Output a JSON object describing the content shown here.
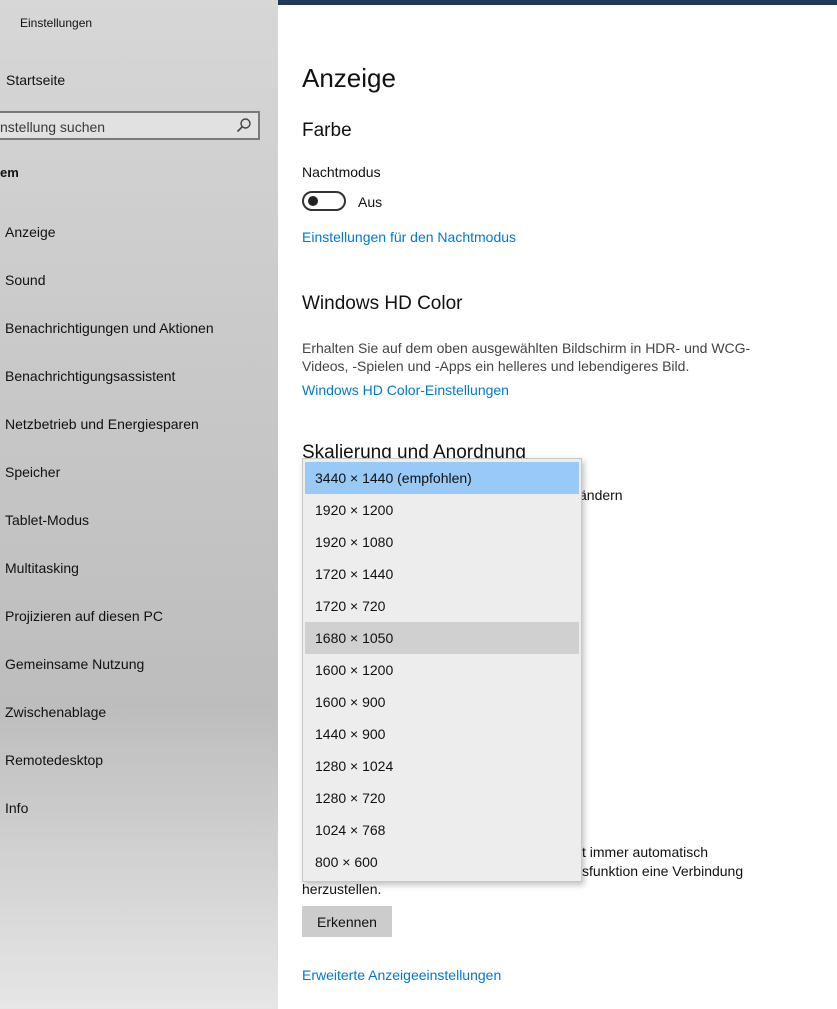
{
  "app": {
    "title": "Einstellungen"
  },
  "sidebar": {
    "home": "Startseite",
    "search_placeholder": "nstellung suchen",
    "group": "em",
    "items": [
      "Anzeige",
      "Sound",
      "Benachrichtigungen und Aktionen",
      "Benachrichtigungsassistent",
      "Netzbetrieb und Energiesparen",
      "Speicher",
      "Tablet-Modus",
      "Multitasking",
      "Projizieren auf diesen PC",
      "Gemeinsame Nutzung",
      "Zwischenablage",
      "Remotedesktop",
      "Info"
    ]
  },
  "main": {
    "title": "Anzeige",
    "color_heading": "Farbe",
    "night_mode_label": "Nachtmodus",
    "night_mode_state": "Aus",
    "night_mode_link": "Einstellungen für den Nachtmodus",
    "hd_heading": "Windows HD Color",
    "hd_desc_line1": "Erhalten Sie auf dem oben ausgewählten Bildschirm in HDR- und WCG-",
    "hd_desc_line2": "Videos, -Spielen und -Apps ein helleres und lebendigeres Bild.",
    "hd_link": "Windows HD Color-Einstellungen",
    "scaling_heading": "Skalierung und Anordnung",
    "scaling_partial": "ändern",
    "detect_line1_tail": "t immer automatisch",
    "detect_line2_tail": "sfunktion eine Verbindung",
    "detect_line3": "herzustellen.",
    "detect_button": "Erkennen",
    "advanced_link": "Erweiterte Anzeigeeinstellungen"
  },
  "resolution_dropdown": {
    "selected_index": 0,
    "hover_index": 5,
    "options": [
      "3440 × 1440 (empfohlen)",
      "1920 × 1200",
      "1920 × 1080",
      "1720 × 1440",
      "1720 × 720",
      "1680 × 1050",
      "1600 × 1200",
      "1600 × 900",
      "1440 × 900",
      "1280 × 1024",
      "1280 × 720",
      "1024 × 768",
      "800 × 600"
    ]
  },
  "colors": {
    "accent": "#0078d7",
    "selected": "#99c9f7",
    "hover": "#d0d0d0"
  },
  "icons": {
    "search": "search-icon"
  }
}
